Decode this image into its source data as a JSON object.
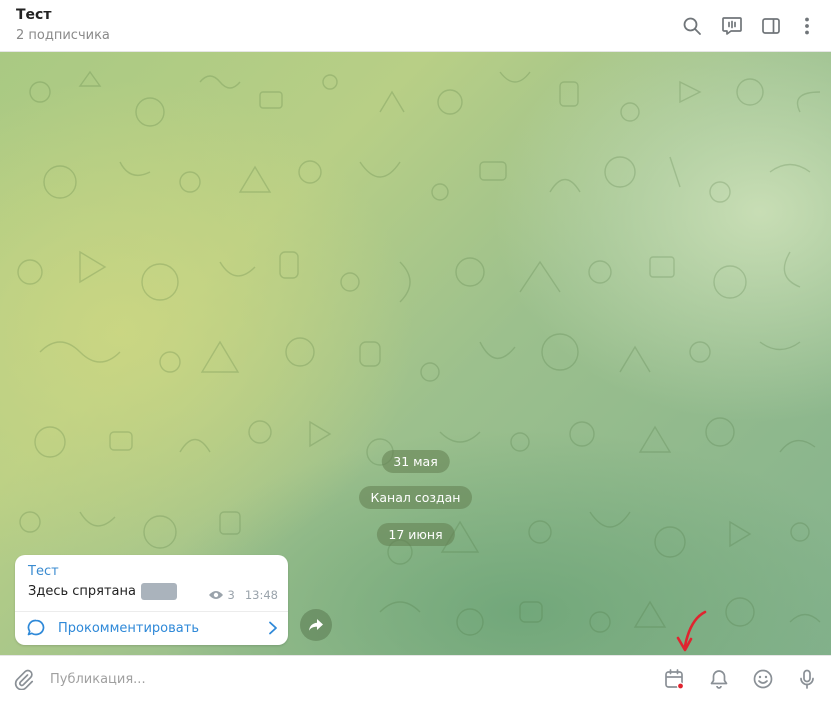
{
  "header": {
    "title": "Тест",
    "subtitle": "2 подписчика",
    "icons": [
      "search-icon",
      "live-stream-icon",
      "sidebar-toggle-icon",
      "more-vertical-icon"
    ]
  },
  "chat": {
    "service_messages": [
      "31 мая",
      "Канал создан",
      "17 июня"
    ],
    "post": {
      "author": "Тест",
      "text": "Здесь спрятана",
      "views": "3",
      "time": "13:48",
      "comment_label": "Прокомментировать"
    }
  },
  "composer": {
    "placeholder": "Публикация...",
    "icons": [
      "attach-icon",
      "schedule-calendar-icon",
      "bell-icon",
      "emoji-icon",
      "microphone-icon"
    ]
  },
  "colors": {
    "accent": "#3a8bd0",
    "annotation": "#e0242f",
    "icon_gray": "#707579"
  }
}
